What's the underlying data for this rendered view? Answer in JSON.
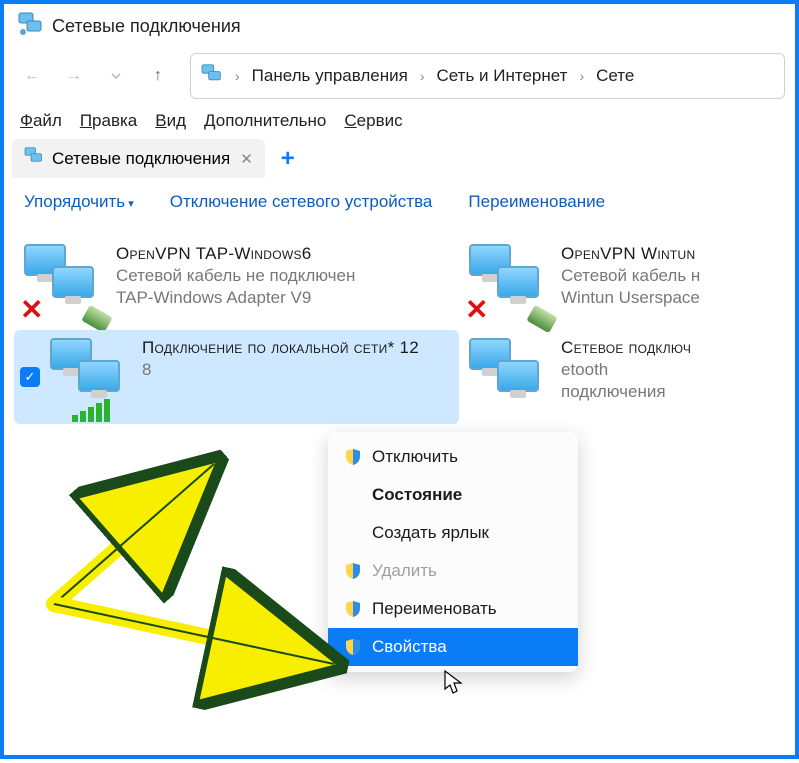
{
  "window": {
    "title": "Сетевые подключения"
  },
  "breadcrumb": {
    "p1": "Панель управления",
    "p2": "Сеть и Интернет",
    "p3": "Сете"
  },
  "menubar": {
    "file": "Файл",
    "edit": "Правка",
    "view": "Вид",
    "extra": "Дополнительно",
    "service": "Сервис"
  },
  "tab": {
    "label": "Сетевые подключения"
  },
  "toolbar": {
    "sort": "Упорядочить",
    "disable": "Отключение сетевого устройства",
    "rename": "Переименование"
  },
  "connections": [
    {
      "name": "OpenVPN TAP-Windows6",
      "status": "Сетевой кабель не подключен",
      "device": "TAP-Windows Adapter V9",
      "disconnected": true
    },
    {
      "name": "OpenVPN Wintun",
      "status": "Сетевой кабель н",
      "device": "Wintun Userspace",
      "disconnected": true
    },
    {
      "name": "Подключение по локальной сети* 12",
      "status": "",
      "device": "8",
      "selected": true,
      "signal": true
    },
    {
      "name": "Сетевое подключ",
      "status": "etooth",
      "device": "подключения",
      "disconnected": false
    }
  ],
  "context_menu": {
    "disable": "Отключить",
    "state": "Состояние",
    "create_shortcut": "Создать ярлык",
    "delete": "Удалить",
    "rename": "Переименовать",
    "properties": "Свойства"
  }
}
